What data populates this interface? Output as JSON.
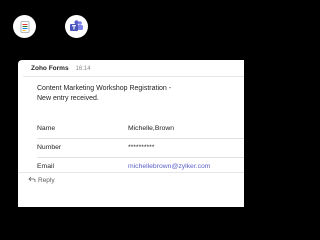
{
  "colors": {
    "background": "#000000",
    "card": "#ffffff",
    "link": "#5b5fc7",
    "teams_brand": "#5b5fc7"
  },
  "icons": {
    "zoho_forms": "zoho-forms-app-icon",
    "teams": "microsoft-teams-app-icon",
    "reply": "reply-arrow-icon"
  },
  "card": {
    "sender": "Zoho Forms",
    "time": "16:14",
    "title_line1": "Content Marketing Workshop Registration -",
    "title_line2": "New entry received.",
    "fields": [
      {
        "label": "Name",
        "value": "Michelle,Brown"
      },
      {
        "label": "Number",
        "value": "**********"
      },
      {
        "label": "Email",
        "value": "michellebrown@zylker.com"
      }
    ],
    "reply_label": "Reply"
  }
}
